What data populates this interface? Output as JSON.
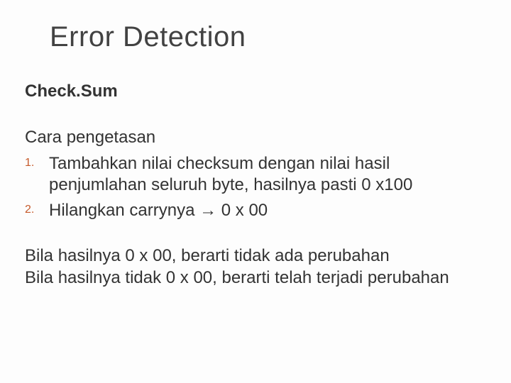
{
  "title": "Error Detection",
  "subtitle": "Check.Sum",
  "section_label": "Cara pengetasan",
  "list": {
    "items": [
      {
        "num": "1.",
        "text": "Tambahkan nilai checksum dengan nilai hasil penjumlahan seluruh byte, hasilnya pasti 0 x100"
      },
      {
        "num": "2.",
        "text": "Hilangkan carrynya → 0 x 00"
      }
    ]
  },
  "conclusion": {
    "line1": "Bila hasilnya 0 x 00, berarti tidak ada perubahan",
    "line2": "Bila hasilnya tidak 0 x 00, berarti telah terjadi perubahan"
  }
}
